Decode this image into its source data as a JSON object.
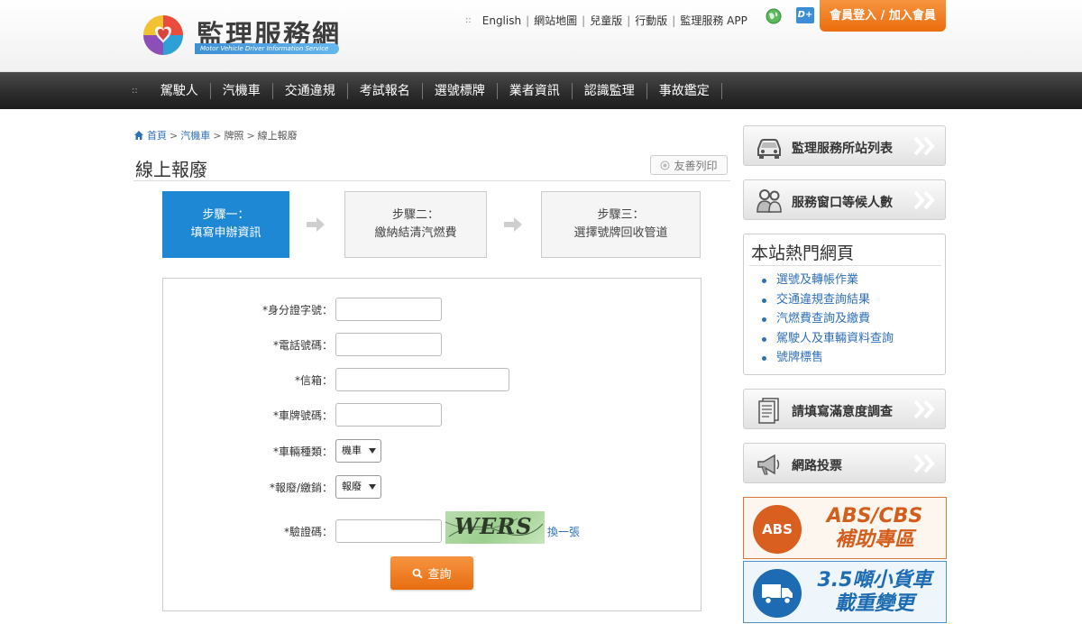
{
  "header": {
    "logo_title": "監理服務網",
    "logo_subtitle": "Motor Vehicle Driver Information Service",
    "top_links_icon": "::",
    "top_links": [
      "English",
      "網站地圖",
      "兒童版",
      "行動版",
      "監理服務 APP"
    ],
    "login_button": "會員登入 / 加入會員",
    "icons": [
      "globe-icon",
      "dplus-icon"
    ]
  },
  "nav": {
    "menu_icon": "::",
    "items": [
      "駕駛人",
      "汽機車",
      "交通違規",
      "考試報名",
      "選號標牌",
      "業者資訊",
      "認識監理",
      "事故鑑定"
    ]
  },
  "breadcrumb": {
    "home": "首頁",
    "level1": "汽機車",
    "level2": "牌照",
    "current": "線上報廢"
  },
  "page": {
    "title": "線上報廢",
    "print_button": "友善列印"
  },
  "steps": [
    {
      "line1": "步驟一：",
      "line2": "填寫申辦資訊",
      "active": true
    },
    {
      "line1": "步驟二：",
      "line2": "繳納結清汽燃費",
      "active": false
    },
    {
      "line1": "步驟三：",
      "line2": "選擇號牌回收管道",
      "active": false
    }
  ],
  "form": {
    "id_label": "*身分證字號：",
    "id_value": "",
    "phone_label": "*電話號碼：",
    "phone_value": "",
    "email_label": "*信箱：",
    "email_value": "",
    "plate_label": "*車牌號碼：",
    "plate_value": "",
    "vehicle_type_label": "*車輛種類：",
    "vehicle_type_value": "機車",
    "action_label": "*報廢/繳銷：",
    "action_value": "報廢",
    "captcha_label": "*驗證碼：",
    "captcha_value": "",
    "captcha_image_text": "WERS",
    "refresh_link": "換一張",
    "submit_button": "查詢"
  },
  "sidebar": {
    "station_list": "監理服務所站列表",
    "wait_count": "服務窗口等候人數",
    "hot_title": "本站熱門網頁",
    "hot_links": [
      "選號及轉帳作業",
      "交通違規查詢結果",
      "汽燃費查詢及繳費",
      "駕駛人及車輛資料查詢",
      "號牌標售"
    ],
    "survey": "請填寫滿意度調查",
    "vote": "網路投票",
    "banner_abs_icon": "ABS",
    "banner_abs_line1": "ABS/CBS",
    "banner_abs_line2": "補助專區",
    "banner_truck_line1": "3.5噸小貨車",
    "banner_truck_line2": "載重變更"
  },
  "colors": {
    "accent_orange": "#ea6d0e",
    "step_active_blue": "#1e88d4",
    "link_blue": "#2f6fb8",
    "nav_dark": "#2b2b2b"
  }
}
